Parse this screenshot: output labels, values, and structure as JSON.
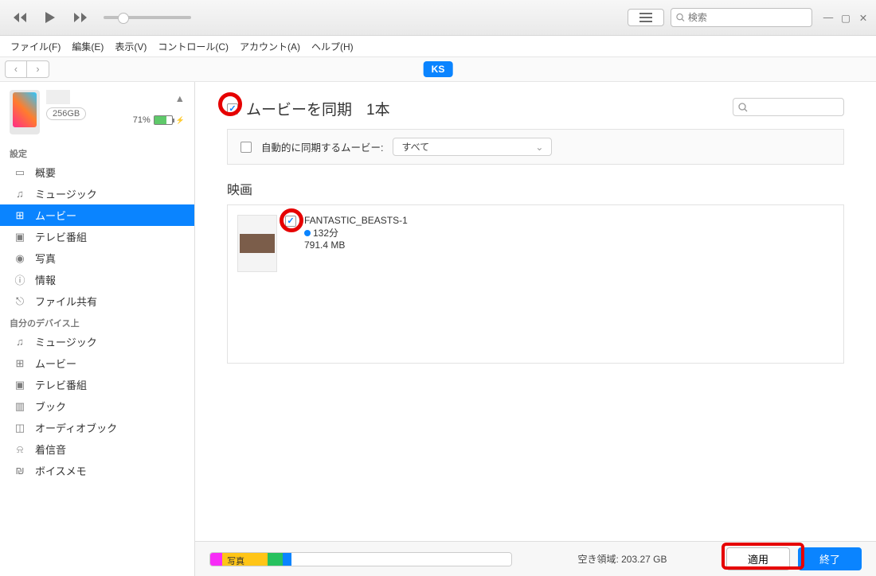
{
  "toolbar": {
    "search_placeholder": "検索"
  },
  "menubar": {
    "file": "ファイル(F)",
    "edit": "編集(E)",
    "view": "表示(V)",
    "controls": "コントロール(C)",
    "account": "アカウント(A)",
    "help": "ヘルプ(H)"
  },
  "navrow": {
    "chip": "KS"
  },
  "device": {
    "capacity": "256GB",
    "battery_pct": "71%"
  },
  "sidebar": {
    "sec_settings": "設定",
    "sec_ondevice": "自分のデバイス上",
    "settings": [
      "概要",
      "ミュージック",
      "ムービー",
      "テレビ番組",
      "写真",
      "情報",
      "ファイル共有"
    ],
    "ondevice": [
      "ミュージック",
      "ムービー",
      "テレビ番組",
      "ブック",
      "オーディオブック",
      "着信音",
      "ボイスメモ"
    ]
  },
  "main": {
    "sync_label": "ムービーを同期",
    "sync_count": "1本",
    "auto_label": "自動的に同期するムービー:",
    "auto_value": "すべて",
    "movies_heading": "映画",
    "movie": {
      "title": "FANTASTIC_BEASTS-1",
      "duration": "132分",
      "size": "791.4 MB"
    }
  },
  "footer": {
    "photo_label": "写真",
    "free_label": "空き領域: 203.27 GB",
    "apply": "適用",
    "done": "終了"
  }
}
